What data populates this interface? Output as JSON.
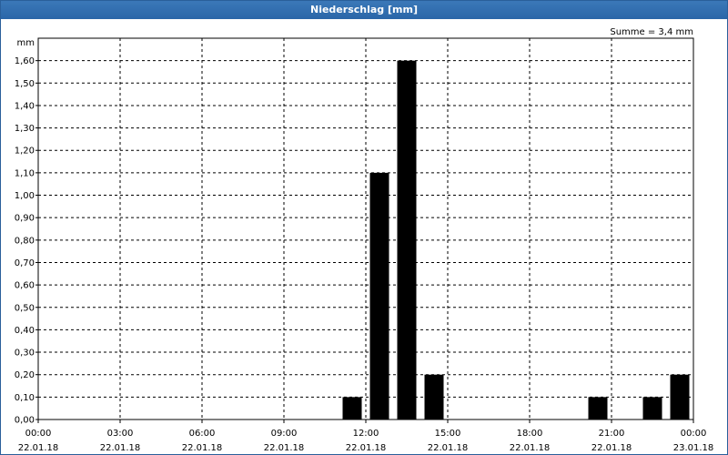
{
  "window": {
    "title": "Niederschlag [mm]"
  },
  "chart_data": {
    "type": "bar",
    "title": "Niederschlag [mm]",
    "ylabel": "mm",
    "annotation": "Summe = 3,4 mm",
    "ylim": [
      0,
      1.7
    ],
    "yticks": [
      "0,00",
      "0,10",
      "0,20",
      "0,30",
      "0,40",
      "0,50",
      "0,60",
      "0,70",
      "0,80",
      "0,90",
      "1,00",
      "1,10",
      "1,20",
      "1,30",
      "1,40",
      "1,50",
      "1,60"
    ],
    "xrange_hours": [
      0,
      24
    ],
    "xticks": [
      {
        "time": "00:00",
        "date": "22.01.18",
        "hour": 0
      },
      {
        "time": "03:00",
        "date": "22.01.18",
        "hour": 3
      },
      {
        "time": "06:00",
        "date": "22.01.18",
        "hour": 6
      },
      {
        "time": "09:00",
        "date": "22.01.18",
        "hour": 9
      },
      {
        "time": "12:00",
        "date": "22.01.18",
        "hour": 12
      },
      {
        "time": "15:00",
        "date": "22.01.18",
        "hour": 15
      },
      {
        "time": "18:00",
        "date": "22.01.18",
        "hour": 18
      },
      {
        "time": "21:00",
        "date": "22.01.18",
        "hour": 21
      },
      {
        "time": "00:00",
        "date": "23.01.18",
        "hour": 24
      }
    ],
    "bars": [
      {
        "hour": 11.5,
        "value": 0.1
      },
      {
        "hour": 12.5,
        "value": 1.1
      },
      {
        "hour": 13.5,
        "value": 1.6
      },
      {
        "hour": 14.5,
        "value": 0.2
      },
      {
        "hour": 20.5,
        "value": 0.1
      },
      {
        "hour": 22.5,
        "value": 0.1
      },
      {
        "hour": 23.5,
        "value": 0.2
      }
    ],
    "grid": true,
    "colors": {
      "bar": "#000000",
      "grid": "#000000",
      "title_bar": "#2a66a8"
    }
  }
}
